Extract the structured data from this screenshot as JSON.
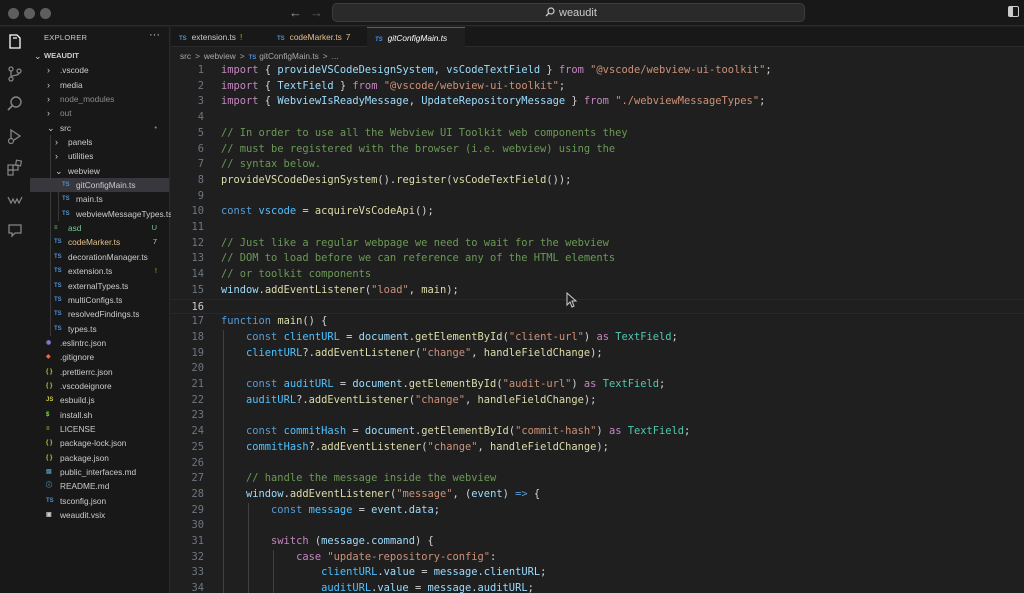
{
  "titlebar": {
    "search_text": "weaudit",
    "back_icon": "arrow-left-icon",
    "forward_icon": "arrow-right-icon"
  },
  "activity_bar": {
    "icons": [
      "files-icon",
      "source-control-icon",
      "search-icon",
      "run-debug-icon",
      "extensions-icon",
      "weaudit-icon",
      "comment-icon"
    ]
  },
  "sidebar": {
    "title": "EXPLORER",
    "more": "···",
    "root": "WEAUDIT",
    "items": [
      {
        "label": ".vscode",
        "type": "folder",
        "depth": 1,
        "expanded": false,
        "color": "#cccccc"
      },
      {
        "label": "media",
        "type": "folder",
        "depth": 1,
        "expanded": false,
        "color": "#cccccc"
      },
      {
        "label": "node_modules",
        "type": "folder",
        "depth": 1,
        "expanded": false,
        "color": "#8c8c8c"
      },
      {
        "label": "out",
        "type": "folder",
        "depth": 1,
        "expanded": false,
        "color": "#8c8c8c"
      },
      {
        "label": "src",
        "type": "folder",
        "depth": 1,
        "expanded": true,
        "color": "#cccccc",
        "badge": "•",
        "badge_color": "#8c8c8c"
      },
      {
        "label": "panels",
        "type": "folder",
        "depth": 2,
        "expanded": false,
        "color": "#cccccc"
      },
      {
        "label": "utilities",
        "type": "folder",
        "depth": 2,
        "expanded": false,
        "color": "#cccccc"
      },
      {
        "label": "webview",
        "type": "folder",
        "depth": 2,
        "expanded": true,
        "color": "#cccccc"
      },
      {
        "label": "gitConfigMain.ts",
        "type": "ts",
        "depth": 3,
        "color": "#cccccc",
        "selected": true
      },
      {
        "label": "main.ts",
        "type": "ts",
        "depth": 3,
        "color": "#cccccc"
      },
      {
        "label": "webviewMessageTypes.ts",
        "type": "ts",
        "depth": 3,
        "color": "#cccccc"
      },
      {
        "label": "asd",
        "type": "plain",
        "depth": 2,
        "color": "#73c991",
        "badge": "U",
        "badge_color": "#73c991"
      },
      {
        "label": "codeMarker.ts",
        "type": "ts",
        "depth": 2,
        "color": "#e2c08d",
        "badge": "7",
        "badge_color": "#e2c08d"
      },
      {
        "label": "decorationManager.ts",
        "type": "ts",
        "depth": 2,
        "color": "#cccccc"
      },
      {
        "label": "extension.ts",
        "type": "ts",
        "depth": 2,
        "color": "#cccccc",
        "badge": "!",
        "badge_color": "#cca700"
      },
      {
        "label": "externalTypes.ts",
        "type": "ts",
        "depth": 2,
        "color": "#cccccc"
      },
      {
        "label": "multiConfigs.ts",
        "type": "ts",
        "depth": 2,
        "color": "#cccccc"
      },
      {
        "label": "resolvedFindings.ts",
        "type": "ts",
        "depth": 2,
        "color": "#cccccc"
      },
      {
        "label": "types.ts",
        "type": "ts",
        "depth": 2,
        "color": "#cccccc"
      },
      {
        "label": ".eslintrc.json",
        "type": "eslint",
        "depth": 1,
        "color": "#cccccc"
      },
      {
        "label": ".gitignore",
        "type": "git",
        "depth": 1,
        "color": "#cccccc"
      },
      {
        "label": ".prettierrc.json",
        "type": "json",
        "depth": 1,
        "color": "#cccccc"
      },
      {
        "label": ".vscodeignore",
        "type": "json",
        "depth": 1,
        "color": "#cccccc"
      },
      {
        "label": "esbuild.js",
        "type": "js",
        "depth": 1,
        "color": "#cccccc"
      },
      {
        "label": "install.sh",
        "type": "sh",
        "depth": 1,
        "color": "#cccccc"
      },
      {
        "label": "LICENSE",
        "type": "license",
        "depth": 1,
        "color": "#cccccc"
      },
      {
        "label": "package-lock.json",
        "type": "json",
        "depth": 1,
        "color": "#cccccc"
      },
      {
        "label": "package.json",
        "type": "json",
        "depth": 1,
        "color": "#cccccc"
      },
      {
        "label": "public_interfaces.md",
        "type": "md",
        "depth": 1,
        "color": "#cccccc"
      },
      {
        "label": "README.md",
        "type": "info",
        "depth": 1,
        "color": "#cccccc"
      },
      {
        "label": "tsconfig.json",
        "type": "tsconfig",
        "depth": 1,
        "color": "#cccccc"
      },
      {
        "label": "weaudit.vsix",
        "type": "vsix",
        "depth": 1,
        "color": "#cccccc"
      }
    ]
  },
  "tabs": [
    {
      "label": "extension.ts",
      "suffix": "!",
      "suffix_color": "#cca700",
      "active": false
    },
    {
      "label": "codeMarker.ts",
      "suffix": "7",
      "suffix_color": "#e2c08d",
      "active": false,
      "label_color": "#e2c08d"
    },
    {
      "label": "gitConfigMain.ts",
      "suffix": "",
      "active": true
    }
  ],
  "breadcrumb": [
    "src",
    ">",
    "webview",
    ">",
    "gitConfigMain.ts",
    ">",
    "..."
  ],
  "editor": {
    "current_line": 16,
    "lines": [
      [
        [
          "kw2",
          "import"
        ],
        [
          "pl",
          " { "
        ],
        [
          "var",
          "provideVSCodeDesignSystem"
        ],
        [
          "pl",
          ", "
        ],
        [
          "var",
          "vsCodeTextField"
        ],
        [
          "pl",
          " } "
        ],
        [
          "kw2",
          "from"
        ],
        [
          "pl",
          " "
        ],
        [
          "str",
          "\"@vscode/webview-ui-toolkit\""
        ],
        [
          "pl",
          ";"
        ]
      ],
      [
        [
          "kw2",
          "import"
        ],
        [
          "pl",
          " { "
        ],
        [
          "var",
          "TextField"
        ],
        [
          "pl",
          " } "
        ],
        [
          "kw2",
          "from"
        ],
        [
          "pl",
          " "
        ],
        [
          "str",
          "\"@vscode/webview-ui-toolkit\""
        ],
        [
          "pl",
          ";"
        ]
      ],
      [
        [
          "kw2",
          "import"
        ],
        [
          "pl",
          " { "
        ],
        [
          "var",
          "WebviewIsReadyMessage"
        ],
        [
          "pl",
          ", "
        ],
        [
          "var",
          "UpdateRepositoryMessage"
        ],
        [
          "pl",
          " } "
        ],
        [
          "kw2",
          "from"
        ],
        [
          "pl",
          " "
        ],
        [
          "str",
          "\"./webviewMessageTypes\""
        ],
        [
          "pl",
          ";"
        ]
      ],
      [],
      [
        [
          "cmt",
          "// In order to use all the Webview UI Toolkit web components they"
        ]
      ],
      [
        [
          "cmt",
          "// must be registered with the browser (i.e. webview) using the"
        ]
      ],
      [
        [
          "cmt",
          "// syntax below."
        ]
      ],
      [
        [
          "fn",
          "provideVSCodeDesignSystem"
        ],
        [
          "pl",
          "()."
        ],
        [
          "fn",
          "register"
        ],
        [
          "pl",
          "("
        ],
        [
          "fn",
          "vsCodeTextField"
        ],
        [
          "pl",
          "());"
        ]
      ],
      [],
      [
        [
          "kw",
          "const"
        ],
        [
          "pl",
          " "
        ],
        [
          "cst",
          "vscode"
        ],
        [
          "pl",
          " = "
        ],
        [
          "fn",
          "acquireVsCodeApi"
        ],
        [
          "pl",
          "();"
        ]
      ],
      [],
      [
        [
          "cmt",
          "// Just like a regular webpage we need to wait for the webview"
        ]
      ],
      [
        [
          "cmt",
          "// DOM to load before we can reference any of the HTML elements"
        ]
      ],
      [
        [
          "cmt",
          "// or toolkit components"
        ]
      ],
      [
        [
          "var",
          "window"
        ],
        [
          "pl",
          "."
        ],
        [
          "fn",
          "addEventListener"
        ],
        [
          "pl",
          "("
        ],
        [
          "str",
          "\"load\""
        ],
        [
          "pl",
          ", "
        ],
        [
          "fn",
          "main"
        ],
        [
          "pl",
          ");"
        ]
      ],
      [],
      [
        [
          "kw",
          "function"
        ],
        [
          "pl",
          " "
        ],
        [
          "fn",
          "main"
        ],
        [
          "pl",
          "() {"
        ]
      ],
      [
        [
          "pl",
          "    "
        ],
        [
          "kw",
          "const"
        ],
        [
          "pl",
          " "
        ],
        [
          "cst",
          "clientURL"
        ],
        [
          "pl",
          " = "
        ],
        [
          "var",
          "document"
        ],
        [
          "pl",
          "."
        ],
        [
          "fn",
          "getElementById"
        ],
        [
          "pl",
          "("
        ],
        [
          "str",
          "\"client-url\""
        ],
        [
          "pl",
          ") "
        ],
        [
          "kw2",
          "as"
        ],
        [
          "pl",
          " "
        ],
        [
          "typ",
          "TextField"
        ],
        [
          "pl",
          ";"
        ]
      ],
      [
        [
          "pl",
          "    "
        ],
        [
          "cst",
          "clientURL"
        ],
        [
          "pl",
          "?."
        ],
        [
          "fn",
          "addEventListener"
        ],
        [
          "pl",
          "("
        ],
        [
          "str",
          "\"change\""
        ],
        [
          "pl",
          ", "
        ],
        [
          "fn",
          "handleFieldChange"
        ],
        [
          "pl",
          ");"
        ]
      ],
      [],
      [
        [
          "pl",
          "    "
        ],
        [
          "kw",
          "const"
        ],
        [
          "pl",
          " "
        ],
        [
          "cst",
          "auditURL"
        ],
        [
          "pl",
          " = "
        ],
        [
          "var",
          "document"
        ],
        [
          "pl",
          "."
        ],
        [
          "fn",
          "getElementById"
        ],
        [
          "pl",
          "("
        ],
        [
          "str",
          "\"audit-url\""
        ],
        [
          "pl",
          ") "
        ],
        [
          "kw2",
          "as"
        ],
        [
          "pl",
          " "
        ],
        [
          "typ",
          "TextField"
        ],
        [
          "pl",
          ";"
        ]
      ],
      [
        [
          "pl",
          "    "
        ],
        [
          "cst",
          "auditURL"
        ],
        [
          "pl",
          "?."
        ],
        [
          "fn",
          "addEventListener"
        ],
        [
          "pl",
          "("
        ],
        [
          "str",
          "\"change\""
        ],
        [
          "pl",
          ", "
        ],
        [
          "fn",
          "handleFieldChange"
        ],
        [
          "pl",
          ");"
        ]
      ],
      [],
      [
        [
          "pl",
          "    "
        ],
        [
          "kw",
          "const"
        ],
        [
          "pl",
          " "
        ],
        [
          "cst",
          "commitHash"
        ],
        [
          "pl",
          " = "
        ],
        [
          "var",
          "document"
        ],
        [
          "pl",
          "."
        ],
        [
          "fn",
          "getElementById"
        ],
        [
          "pl",
          "("
        ],
        [
          "str",
          "\"commit-hash\""
        ],
        [
          "pl",
          ") "
        ],
        [
          "kw2",
          "as"
        ],
        [
          "pl",
          " "
        ],
        [
          "typ",
          "TextField"
        ],
        [
          "pl",
          ";"
        ]
      ],
      [
        [
          "pl",
          "    "
        ],
        [
          "cst",
          "commitHash"
        ],
        [
          "pl",
          "?."
        ],
        [
          "fn",
          "addEventListener"
        ],
        [
          "pl",
          "("
        ],
        [
          "str",
          "\"change\""
        ],
        [
          "pl",
          ", "
        ],
        [
          "fn",
          "handleFieldChange"
        ],
        [
          "pl",
          ");"
        ]
      ],
      [],
      [
        [
          "pl",
          "    "
        ],
        [
          "cmt",
          "// handle the message inside the webview"
        ]
      ],
      [
        [
          "pl",
          "    "
        ],
        [
          "var",
          "window"
        ],
        [
          "pl",
          "."
        ],
        [
          "fn",
          "addEventListener"
        ],
        [
          "pl",
          "("
        ],
        [
          "str",
          "\"message\""
        ],
        [
          "pl",
          ", ("
        ],
        [
          "var",
          "event"
        ],
        [
          "pl",
          ") "
        ],
        [
          "kw",
          "=>"
        ],
        [
          "pl",
          " {"
        ]
      ],
      [
        [
          "pl",
          "        "
        ],
        [
          "kw",
          "const"
        ],
        [
          "pl",
          " "
        ],
        [
          "cst",
          "message"
        ],
        [
          "pl",
          " = "
        ],
        [
          "var",
          "event"
        ],
        [
          "pl",
          "."
        ],
        [
          "var",
          "data"
        ],
        [
          "pl",
          ";"
        ]
      ],
      [],
      [
        [
          "pl",
          "        "
        ],
        [
          "kw2",
          "switch"
        ],
        [
          "pl",
          " ("
        ],
        [
          "var",
          "message"
        ],
        [
          "pl",
          "."
        ],
        [
          "var",
          "command"
        ],
        [
          "pl",
          ") {"
        ]
      ],
      [
        [
          "pl",
          "            "
        ],
        [
          "kw2",
          "case"
        ],
        [
          "pl",
          " "
        ],
        [
          "str",
          "\"update-repository-config\""
        ],
        [
          "pl",
          ":"
        ]
      ],
      [
        [
          "pl",
          "                "
        ],
        [
          "cst",
          "clientURL"
        ],
        [
          "pl",
          "."
        ],
        [
          "var",
          "value"
        ],
        [
          "pl",
          " = "
        ],
        [
          "var",
          "message"
        ],
        [
          "pl",
          "."
        ],
        [
          "var",
          "clientURL"
        ],
        [
          "pl",
          ";"
        ]
      ],
      [
        [
          "pl",
          "                "
        ],
        [
          "cst",
          "auditURL"
        ],
        [
          "pl",
          "."
        ],
        [
          "var",
          "value"
        ],
        [
          "pl",
          " = "
        ],
        [
          "var",
          "message"
        ],
        [
          "pl",
          "."
        ],
        [
          "var",
          "auditURL"
        ],
        [
          "pl",
          ";"
        ]
      ]
    ]
  }
}
